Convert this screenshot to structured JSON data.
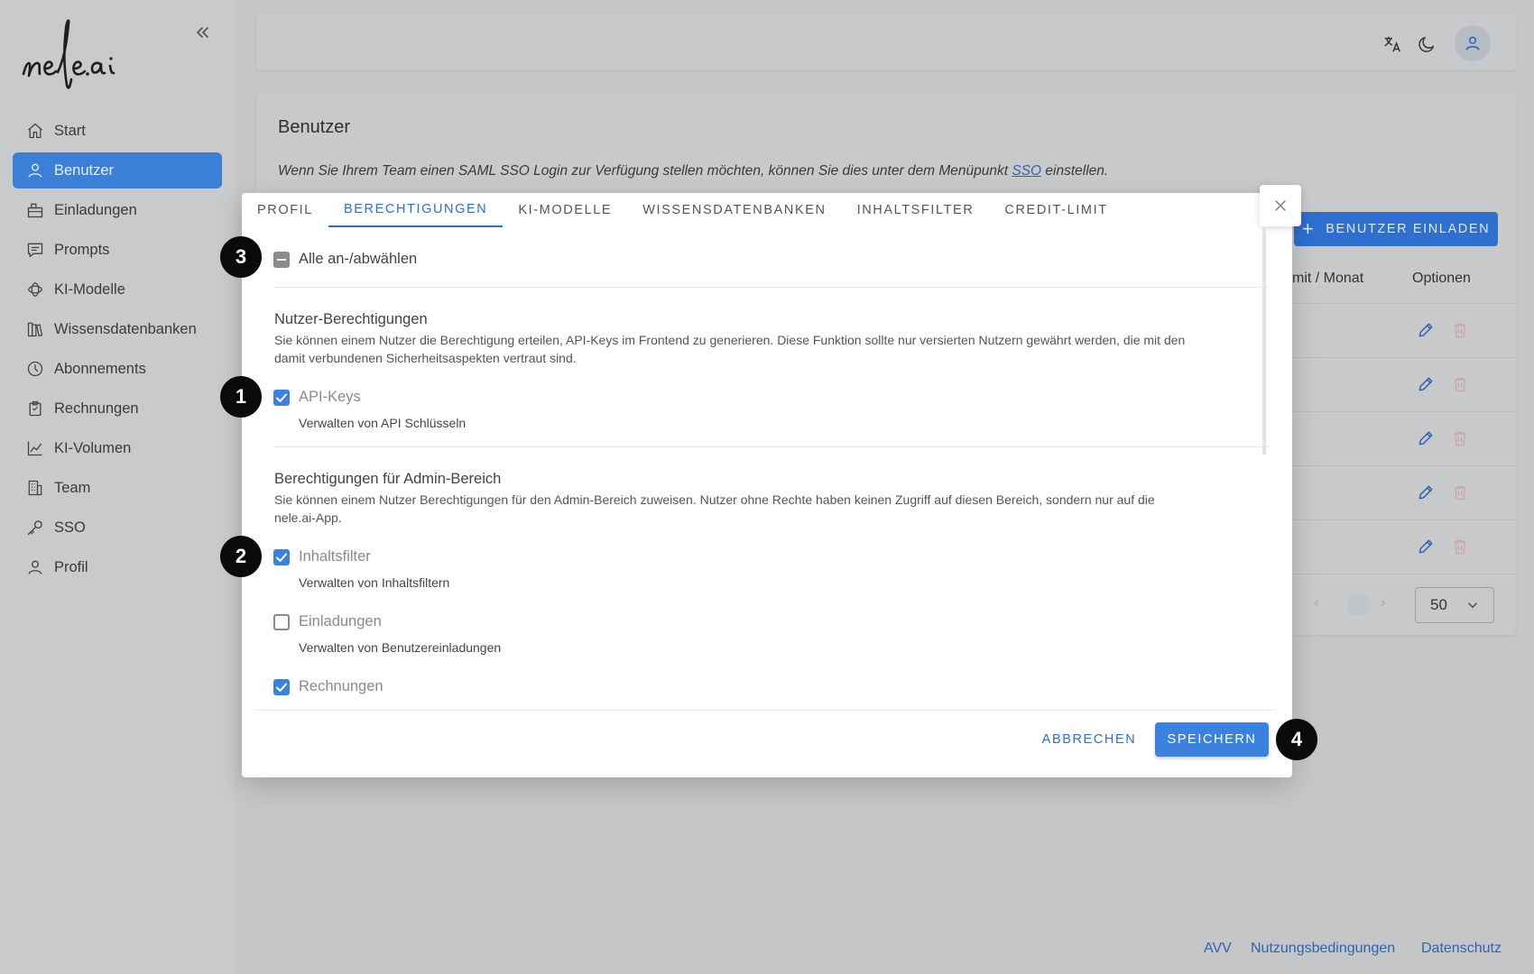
{
  "brand": {
    "logo_text": "nele.ai"
  },
  "sidebar": {
    "items": [
      {
        "label": "Start",
        "icon": "home-icon"
      },
      {
        "label": "Benutzer",
        "icon": "user-icon"
      },
      {
        "label": "Einladungen",
        "icon": "invite-icon"
      },
      {
        "label": "Prompts",
        "icon": "chat-icon"
      },
      {
        "label": "KI-Modelle",
        "icon": "model-icon"
      },
      {
        "label": "Wissensdatenbanken",
        "icon": "books-icon"
      },
      {
        "label": "Abonnements",
        "icon": "clock-icon"
      },
      {
        "label": "Rechnungen",
        "icon": "clipboard-icon"
      },
      {
        "label": "KI-Volumen",
        "icon": "chart-icon"
      },
      {
        "label": "Team",
        "icon": "building-icon"
      },
      {
        "label": "SSO",
        "icon": "key-icon"
      },
      {
        "label": "Profil",
        "icon": "profile-icon"
      }
    ],
    "active_index": 1
  },
  "page": {
    "title": "Benutzer",
    "info_before": "Wenn Sie Ihrem Team einen SAML SSO Login zur Verfügung stellen möchten, können Sie dies unter dem Menüpunkt ",
    "info_link": "SSO",
    "info_after": " einstellen.",
    "invite_button": "BENUTZER EINLADEN",
    "columns": {
      "limit": "mit / Monat",
      "options": "Optionen"
    },
    "page_size": "50"
  },
  "footer": {
    "avv": "AVV",
    "terms": "Nutzungsbedingungen",
    "privacy": "Datenschutz"
  },
  "modal": {
    "tabs": [
      "PROFIL",
      "BERECHTIGUNGEN",
      "KI-MODELLE",
      "WISSENSDATENBANKEN",
      "INHALTSFILTER",
      "CREDIT-LIMIT"
    ],
    "active_tab": 1,
    "select_all": "Alle an-/abwählen",
    "user_section": {
      "title": "Nutzer-Berechtigungen",
      "desc_line1": "Sie können einem Nutzer die Berechtigung erteilen, API-Keys im Frontend zu generieren. Diese Funktion sollte nur versierten Nutzern gewährt werden, die mit den",
      "desc_line2": "damit verbundenen Sicherheitsaspekten vertraut sind.",
      "api_keys_label": "API-Keys",
      "api_keys_desc": "Verwalten von API Schlüsseln"
    },
    "admin_section": {
      "title": "Berechtigungen für Admin-Bereich",
      "desc_line1": "Sie können einem Nutzer Berechtigungen für den Admin-Bereich zuweisen. Nutzer ohne Rechte haben keinen Zugriff auf diesen Bereich, sondern nur auf die",
      "desc_line2": "nele.ai-App.",
      "filter_label": "Inhaltsfilter",
      "filter_desc": "Verwalten von Inhaltsfiltern",
      "invites_label": "Einladungen",
      "invites_desc": "Verwalten von Benutzereinladungen",
      "invoices_label": "Rechnungen"
    },
    "permissions": {
      "api_keys": true,
      "inhaltsfilter": true,
      "einladungen": false,
      "rechnungen": true
    },
    "cancel": "ABBRECHEN",
    "save": "SPEICHERN"
  },
  "markers": [
    "1",
    "2",
    "3",
    "4"
  ],
  "colors": {
    "primary": "#3b82e0",
    "accent_dark": "#2e6fd0",
    "overlay": "#c5c6c8"
  }
}
